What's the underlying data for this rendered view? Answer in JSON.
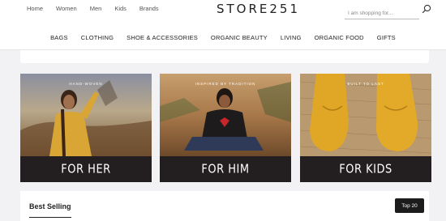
{
  "header": {
    "top_links": [
      "Home",
      "Women",
      "Men",
      "Kids",
      "Brands"
    ],
    "logo": "STORE251",
    "search_placeholder": "I am shopping for..."
  },
  "categories": [
    "BAGS",
    "CLOTHING",
    "SHOE & ACCESSORIES",
    "ORGANIC BEAUTY",
    "LIVING",
    "ORGANIC FOOD",
    "GIFTS"
  ],
  "tiles": [
    {
      "tag": "HAND-WOVEN",
      "caption": "FOR HER"
    },
    {
      "tag": "INSPIRED BY TRADITION",
      "caption": "FOR HIM"
    },
    {
      "tag": "BUILT TO LAST",
      "caption": "FOR KIDS"
    }
  ],
  "best_selling": {
    "title": "Best Selling",
    "button": "Top 20"
  },
  "colors": {
    "dark": "#231f20",
    "background": "#f2f2f4"
  }
}
